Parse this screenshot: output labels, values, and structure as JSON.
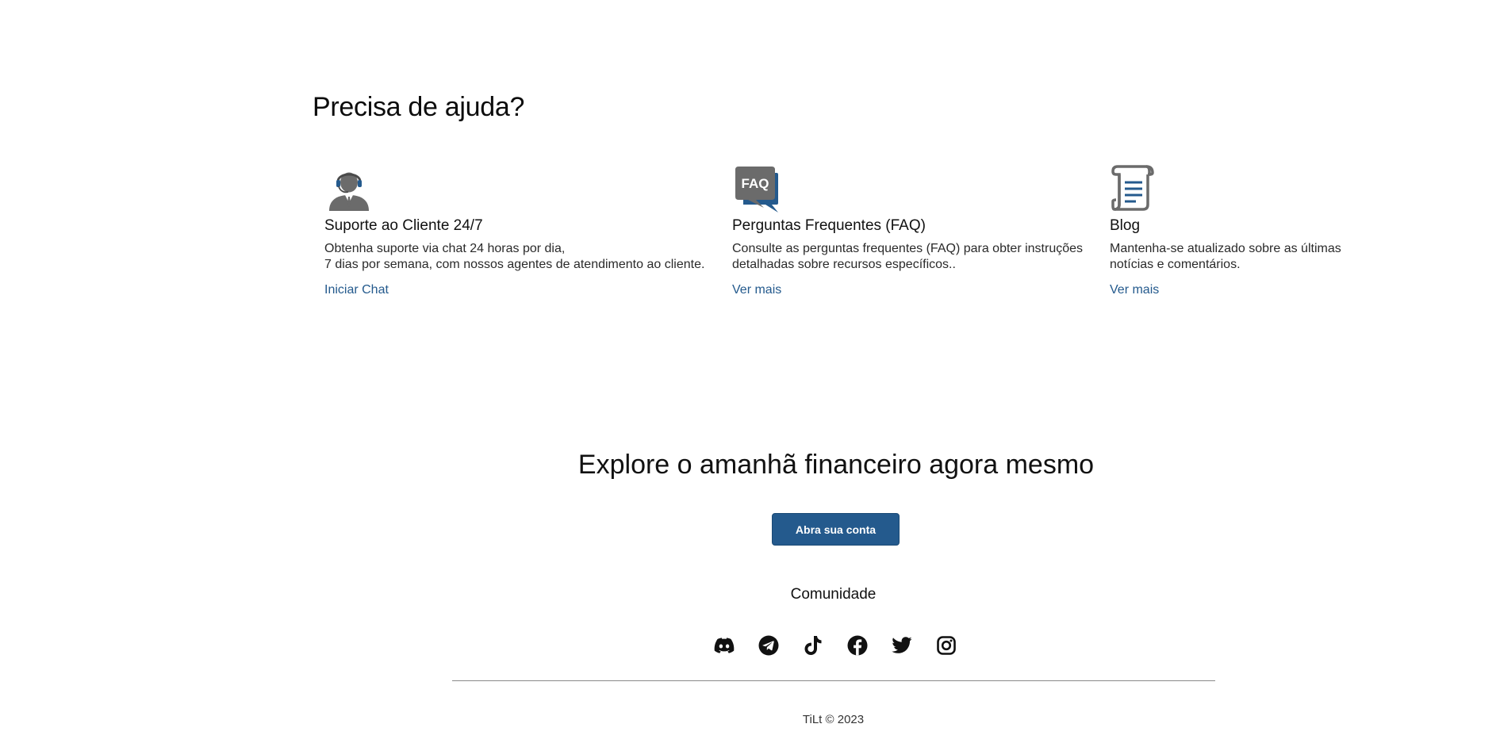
{
  "help": {
    "title": "Precisa de ajuda?",
    "cards": [
      {
        "icon": "support-agent-icon",
        "title": "Suporte ao Cliente 24/7",
        "desc_line1": "Obtenha suporte via chat 24 horas por dia,",
        "desc_line2": "7 dias por semana, com nossos agentes de atendimento ao cliente.",
        "link": "Iniciar Chat"
      },
      {
        "icon": "faq-bubble-icon",
        "title": "Perguntas Frequentes (FAQ)",
        "desc_line1": "Consulte as perguntas frequentes (FAQ) para obter instruções",
        "desc_line2": "detalhadas sobre recursos específicos..",
        "link": "Ver mais",
        "icon_text": "FAQ"
      },
      {
        "icon": "blog-scroll-icon",
        "title": "Blog",
        "desc_line1": "Mantenha-se atualizado sobre as últimas",
        "desc_line2": "notícias e comentários.",
        "link": "Ver mais"
      }
    ]
  },
  "cta": {
    "title": "Explore o amanhã financeiro agora mesmo",
    "button_label": "Abra sua conta"
  },
  "community": {
    "title": "Comunidade",
    "socials": [
      "discord-icon",
      "telegram-icon",
      "tiktok-icon",
      "facebook-icon",
      "twitter-icon",
      "instagram-icon"
    ]
  },
  "footer": {
    "copyright": "TiLt © 2023"
  },
  "colors": {
    "accent": "#245a8d",
    "icon_gray": "#6b6b6b",
    "text": "#111111"
  }
}
